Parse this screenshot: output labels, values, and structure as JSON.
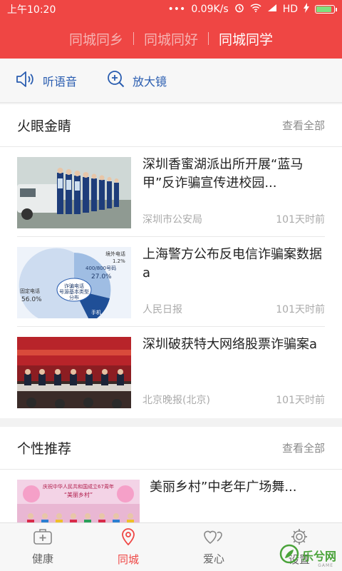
{
  "status_bar": {
    "time": "上午10:20",
    "network_speed": "0.09K/s",
    "network_type": "HD",
    "icons": [
      "dots-icon",
      "alarm-icon",
      "wifi-icon",
      "signal-icon",
      "charging-icon",
      "battery-icon"
    ],
    "battery_level": 0.9
  },
  "header": {
    "tabs": [
      {
        "label": "同城同乡",
        "active": false
      },
      {
        "label": "同城同好",
        "active": false
      },
      {
        "label": "同城同学",
        "active": true
      }
    ]
  },
  "toolbar": {
    "listen_label": "听语音",
    "magnifier_label": "放大镜"
  },
  "sections": [
    {
      "title": "火眼金睛",
      "more_label": "查看全部",
      "items": [
        {
          "title": "深圳香蜜湖派出所开展“蓝马甲”反诈骗宣传进校园...",
          "source": "深圳市公安局",
          "time": "101天时前",
          "thumb": "police-lineup-photo"
        },
        {
          "title": "上海警方公布反电信诈骗案数据a",
          "source": "人民日报",
          "time": "101天时前",
          "thumb": "pie-chart-photo",
          "thumb_text": {
            "center": "诈骗电话号源基本类型分布",
            "label_a": "境外电话",
            "value_a": "1.2%",
            "label_b": "400/800号码",
            "value_b": "27.0%",
            "label_c": "固定电话",
            "value_c": "56.0%",
            "label_d": "手机"
          }
        },
        {
          "title": "深圳破获特大网络股票诈骗案a",
          "source": "北京晚报(北京)",
          "time": "101天时前",
          "thumb": "conference-photo"
        }
      ]
    },
    {
      "title": "个性推荐",
      "more_label": "查看全部",
      "items": [
        {
          "title": "美丽乡村”中老年广场舞...",
          "source": "",
          "time": "",
          "thumb": "dance-stage-photo",
          "thumb_text": {
            "banner": "庆祝中华人民共和国成立67周年",
            "sub": "“美丽乡村”"
          }
        }
      ]
    }
  ],
  "bottom_nav": [
    {
      "label": "健康",
      "icon": "medical-kit-icon",
      "active": false
    },
    {
      "label": "同城",
      "icon": "location-pin-icon",
      "active": true
    },
    {
      "label": "爱心",
      "icon": "hearts-icon",
      "active": false
    },
    {
      "label": "设置",
      "icon": "gear-icon",
      "active": false
    }
  ],
  "watermark": {
    "text": "乐兮网",
    "sub": "GAME"
  },
  "colors": {
    "brand_red": "#ef4644",
    "link_blue": "#2a5db0",
    "active_tab": "#ffffff",
    "inactive_tab": "#f6b3b2"
  }
}
